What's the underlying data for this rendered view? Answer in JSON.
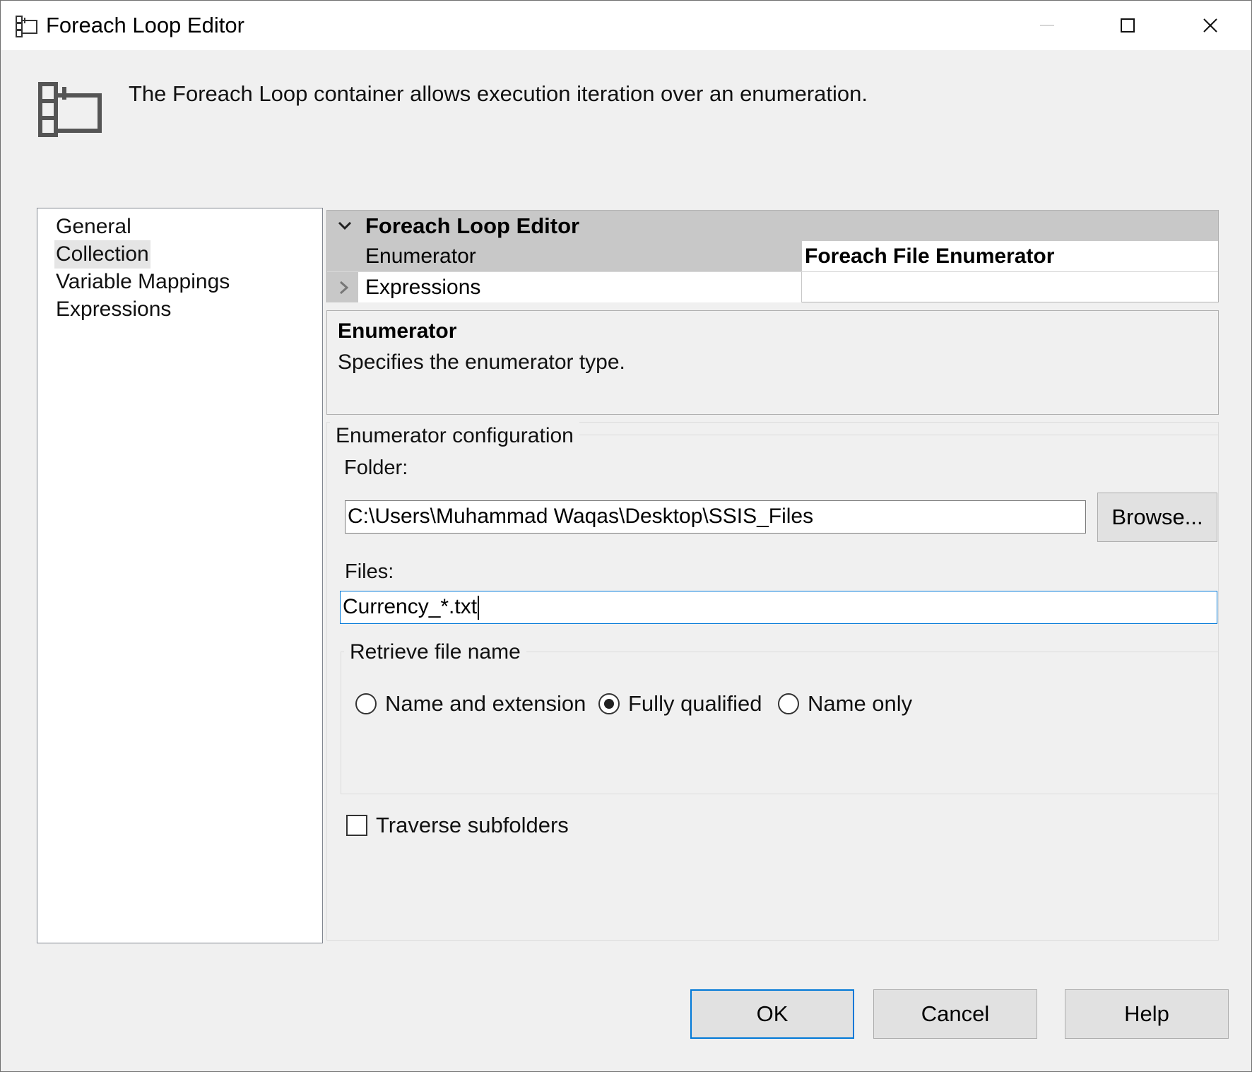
{
  "window": {
    "title": "Foreach Loop Editor",
    "title_icon": "foreach-loop-icon",
    "controls": [
      "minimize-icon",
      "maximize-icon",
      "close-icon"
    ]
  },
  "header": {
    "description": "The Foreach Loop container allows execution iteration over an enumeration.",
    "icon": "foreach-loop-icon"
  },
  "nav": {
    "items": [
      {
        "label": "General",
        "selected": false
      },
      {
        "label": "Collection",
        "selected": true
      },
      {
        "label": "Variable Mappings",
        "selected": false
      },
      {
        "label": "Expressions",
        "selected": false
      }
    ]
  },
  "property_grid": {
    "category": "Foreach Loop Editor",
    "rows": [
      {
        "name": "Enumerator",
        "value": "Foreach File Enumerator"
      },
      {
        "name": "Expressions",
        "value": ""
      }
    ]
  },
  "help_panel": {
    "title": "Enumerator",
    "description": "Specifies the enumerator type."
  },
  "enumerator_config": {
    "legend": "Enumerator configuration",
    "folder_label": "Folder:",
    "folder_value": "C:\\Users\\Muhammad Waqas\\Desktop\\SSIS_Files",
    "browse_label": "Browse...",
    "files_label": "Files:",
    "files_value": "Currency_*.txt",
    "retrieve": {
      "legend": "Retrieve file name",
      "options": [
        {
          "label": "Name and extension",
          "checked": false
        },
        {
          "label": "Fully qualified",
          "checked": true
        },
        {
          "label": "Name only",
          "checked": false
        }
      ]
    },
    "traverse_label": "Traverse subfolders",
    "traverse_checked": false
  },
  "footer": {
    "ok": "OK",
    "cancel": "Cancel",
    "help": "Help"
  },
  "colors": {
    "window_bg": "#f0f0f0",
    "grid_category_bg": "#c8c8c8",
    "focus_accent": "#0078d7"
  }
}
